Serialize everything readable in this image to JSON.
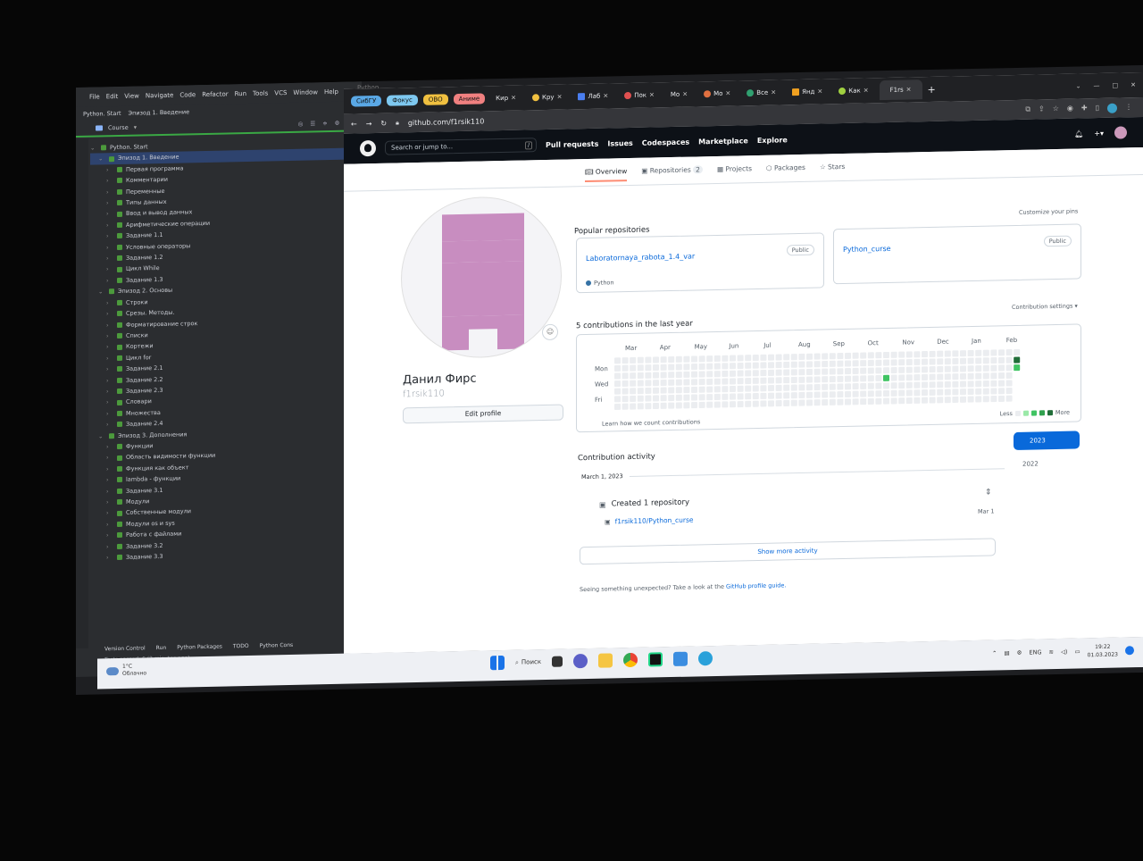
{
  "ide": {
    "menu": [
      "File",
      "Edit",
      "View",
      "Navigate",
      "Code",
      "Refactor",
      "Run",
      "Tools",
      "VCS",
      "Window",
      "Help"
    ],
    "window_title": "Python Start",
    "project": "Python. Start",
    "episode_path": "Эпизод 1. Введение",
    "course_label": "Course",
    "tree": [
      {
        "label": "Python. Start",
        "level": 0,
        "selected": false
      },
      {
        "label": "Эпизод 1. Введение",
        "level": 1,
        "selected": true
      },
      {
        "label": "Первая программа",
        "level": 2
      },
      {
        "label": "Комментарии",
        "level": 2
      },
      {
        "label": "Переменные",
        "level": 2
      },
      {
        "label": "Типы данных",
        "level": 2
      },
      {
        "label": "Ввод и вывод данных",
        "level": 2
      },
      {
        "label": "Арифметические операции",
        "level": 2
      },
      {
        "label": "Задание 1.1",
        "level": 2
      },
      {
        "label": "Условные операторы",
        "level": 2
      },
      {
        "label": "Задание 1.2",
        "level": 2
      },
      {
        "label": "Цикл While",
        "level": 2
      },
      {
        "label": "Задание 1.3",
        "level": 2
      },
      {
        "label": "Эпизод 2. Основы",
        "level": 1
      },
      {
        "label": "Строки",
        "level": 2
      },
      {
        "label": "Срезы. Методы.",
        "level": 2
      },
      {
        "label": "Форматирование строк",
        "level": 2
      },
      {
        "label": "Списки",
        "level": 2
      },
      {
        "label": "Кортежи",
        "level": 2
      },
      {
        "label": "Цикл for",
        "level": 2
      },
      {
        "label": "Задание 2.1",
        "level": 2
      },
      {
        "label": "Задание 2.2",
        "level": 2
      },
      {
        "label": "Задание 2.3",
        "level": 2
      },
      {
        "label": "Словари",
        "level": 2
      },
      {
        "label": "Множества",
        "level": 2
      },
      {
        "label": "Задание 2.4",
        "level": 2
      },
      {
        "label": "Эпизод 3. Дополнения",
        "level": 1
      },
      {
        "label": "Функции",
        "level": 2
      },
      {
        "label": "Область видимости функции",
        "level": 2
      },
      {
        "label": "Функция как объект",
        "level": 2
      },
      {
        "label": "lambda - функции",
        "level": 2
      },
      {
        "label": "Задание 3.1",
        "level": 2
      },
      {
        "label": "Модули",
        "level": 2
      },
      {
        "label": "Собственные модули",
        "level": 2
      },
      {
        "label": "Модули os и sys",
        "level": 2
      },
      {
        "label": "Работа с файлами",
        "level": 2
      },
      {
        "label": "Задание 3.2",
        "level": 2
      },
      {
        "label": "Задание 3.3",
        "level": 2
      }
    ],
    "bottom_tabs": [
      "Version Control",
      "Run",
      "Python Packages",
      "TODO",
      "Python Cons"
    ],
    "status": "Tests passed: 6 (2 minutes ago)"
  },
  "browser": {
    "bookmarks": [
      {
        "label": "СибГУ",
        "color": "#5aa8e6"
      },
      {
        "label": "Фокус",
        "color": "#7ec8f0"
      },
      {
        "label": "ОВО",
        "color": "#f0c040"
      },
      {
        "label": "Аниме",
        "color": "#f08080"
      }
    ],
    "tabs": [
      "Кир",
      "Кру",
      "Лаб",
      "Пок",
      "Мо",
      "Мо",
      "Все",
      "Янд",
      "Как",
      "F1rs"
    ],
    "url": "github.com/f1rsik110"
  },
  "github": {
    "search_placeholder": "Search or jump to...",
    "search_shortcut": "/",
    "nav": [
      "Pull requests",
      "Issues",
      "Codespaces",
      "Marketplace",
      "Explore"
    ],
    "profile_tabs": [
      {
        "label": "Overview",
        "icon": "book-icon"
      },
      {
        "label": "Repositories",
        "count": "2",
        "icon": "repo-icon"
      },
      {
        "label": "Projects",
        "icon": "table-icon"
      },
      {
        "label": "Packages",
        "icon": "package-icon"
      },
      {
        "label": "Stars",
        "icon": "star-icon"
      }
    ],
    "name": "Данил Фирс",
    "login": "f1rsik110",
    "edit_profile": "Edit profile",
    "popular_title": "Popular repositories",
    "customize": "Customize your pins",
    "repos": [
      {
        "name": "Laboratornaya_rabota_1.4_var",
        "visibility": "Public",
        "language": "Python"
      },
      {
        "name": "Python_curse",
        "visibility": "Public",
        "language": ""
      }
    ],
    "contrib_title": "5 contributions in the last year",
    "contrib_settings": "Contribution settings",
    "months": [
      "Mar",
      "Apr",
      "May",
      "Jun",
      "Jul",
      "Aug",
      "Sep",
      "Oct",
      "Nov",
      "Dec",
      "Jan",
      "Feb"
    ],
    "days": [
      "Mon",
      "Wed",
      "Fri"
    ],
    "learn_link": "Learn how we count contributions",
    "legend_less": "Less",
    "legend_more": "More",
    "activity_title": "Contribution activity",
    "years": [
      "2023",
      "2022"
    ],
    "activity_date": "March 1, 2023",
    "activity_created": "Created 1 repository",
    "activity_repo": "f1rsik110/Python_curse",
    "activity_when": "Mar 1",
    "show_more": "Show more activity",
    "unexpected_text": "Seeing something unexpected? Take a look at the",
    "unexpected_link": "GitHub profile guide."
  },
  "taskbar": {
    "temperature": "1°C",
    "weather": "Облачно",
    "search": "Поиск",
    "lang": "ENG",
    "time": "19:22",
    "date": "01.03.2023"
  }
}
